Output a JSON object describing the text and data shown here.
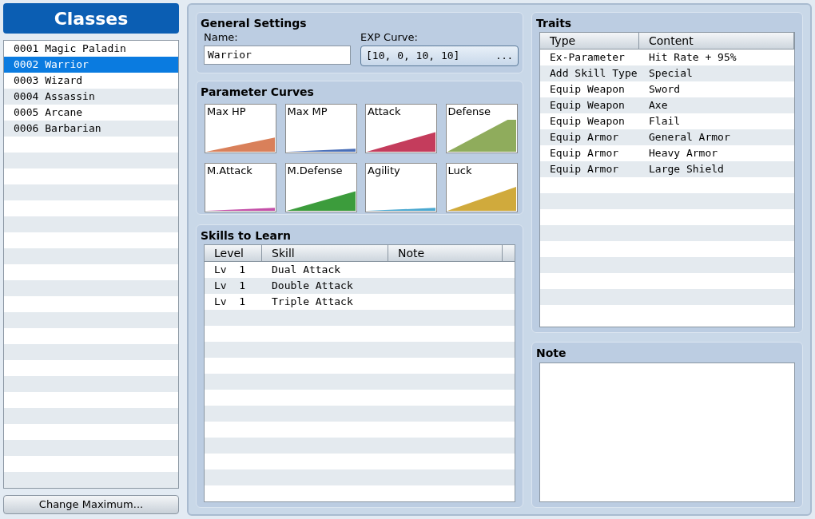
{
  "sidebar": {
    "title": "Classes",
    "items": [
      {
        "label": "0001 Magic Paladin",
        "selected": false
      },
      {
        "label": "0002 Warrior",
        "selected": true
      },
      {
        "label": "0003 Wizard",
        "selected": false
      },
      {
        "label": "0004 Assassin",
        "selected": false
      },
      {
        "label": "0005 Arcane",
        "selected": false
      },
      {
        "label": "0006 Barbarian",
        "selected": false
      }
    ],
    "button": "Change Maximum..."
  },
  "general_settings": {
    "title": "General Settings",
    "name_label": "Name:",
    "name_value": "Warrior",
    "exp_label": "EXP Curve:",
    "exp_value": "[10, 0, 10, 10]",
    "exp_button": "..."
  },
  "parameter_curves": {
    "title": "Parameter Curves",
    "curves": [
      {
        "label": "Max HP",
        "color": "#d9805a"
      },
      {
        "label": "Max MP",
        "color": "#4a6fb8"
      },
      {
        "label": "Attack",
        "color": "#c43c5c"
      },
      {
        "label": "Defense",
        "color": "#8fac5c"
      },
      {
        "label": "M.Attack",
        "color": "#c44fa8"
      },
      {
        "label": "M.Defense",
        "color": "#3c9c3c"
      },
      {
        "label": "Agility",
        "color": "#4aa8d0"
      },
      {
        "label": "Luck",
        "color": "#d0aa3c"
      }
    ]
  },
  "skills": {
    "title": "Skills to Learn",
    "columns": [
      "Level",
      "Skill",
      "Note"
    ],
    "rows": [
      {
        "level": "Lv  1",
        "skill": "Dual Attack"
      },
      {
        "level": "Lv  1",
        "skill": "Double Attack"
      },
      {
        "level": "Lv  1",
        "skill": "Triple Attack"
      }
    ]
  },
  "traits": {
    "title": "Traits",
    "columns": [
      "Type",
      "Content"
    ],
    "rows": [
      {
        "type": "Ex-Parameter",
        "content": "Hit Rate + 95%"
      },
      {
        "type": "Add Skill Type",
        "content": "Special"
      },
      {
        "type": "Equip Weapon",
        "content": "Sword"
      },
      {
        "type": "Equip Weapon",
        "content": "Axe"
      },
      {
        "type": "Equip Weapon",
        "content": "Flail"
      },
      {
        "type": "Equip Armor",
        "content": "General Armor"
      },
      {
        "type": "Equip Armor",
        "content": "Heavy Armor"
      },
      {
        "type": "Equip Armor",
        "content": "Large Shield"
      }
    ]
  },
  "note": {
    "title": "Note"
  }
}
